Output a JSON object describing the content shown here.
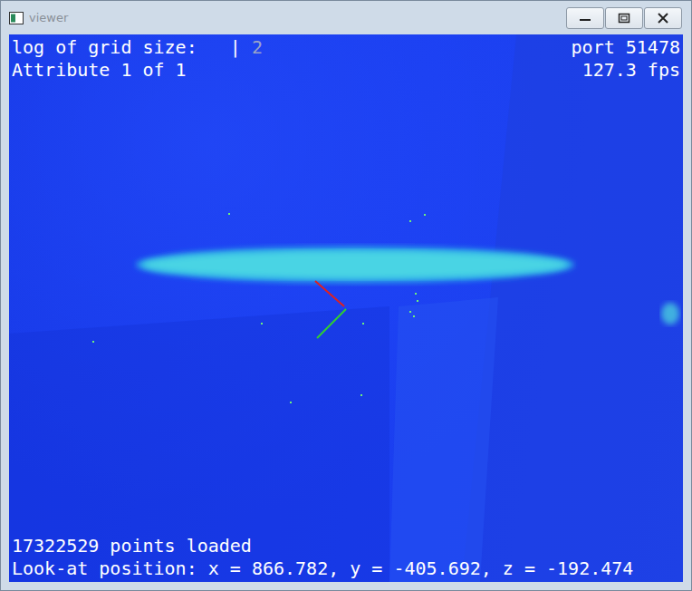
{
  "window": {
    "title": "viewer"
  },
  "overlay": {
    "grid": {
      "label": "log of grid size:",
      "cursor": "|",
      "value": "2"
    },
    "attribute": "Attribute 1 of 1",
    "port": "port 51478",
    "fps": "127.3 fps",
    "points": "17322529 points loaded",
    "look_at": "Look-at position: x = 866.782, y = -405.692, z = -192.474"
  }
}
